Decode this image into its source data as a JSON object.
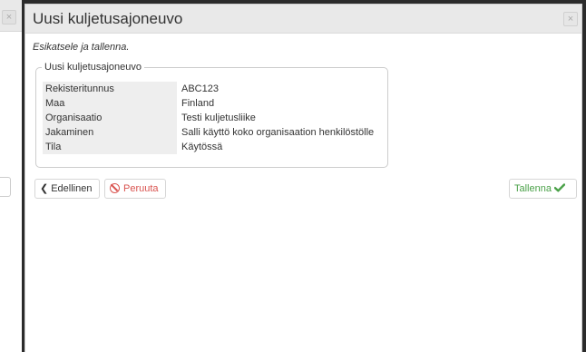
{
  "background_window": {
    "close_glyph": "×"
  },
  "dialog": {
    "title": "Uusi kuljetusajoneuvo",
    "close_glyph": "×",
    "instructions": "Esikatsele ja tallenna.",
    "fieldset_legend": "Uusi kuljetusajoneuvo",
    "rows": [
      {
        "label": "Rekisteritunnus",
        "value": "ABC123"
      },
      {
        "label": "Maa",
        "value": "Finland"
      },
      {
        "label": "Organisaatio",
        "value": "Testi kuljetusliike"
      },
      {
        "label": "Jakaminen",
        "value": "Salli käyttö koko organisaation henkilöstölle"
      },
      {
        "label": "Tila",
        "value": "Käytössä"
      }
    ],
    "buttons": {
      "previous_label": "Edellinen",
      "cancel_label": "Peruuta",
      "save_label": "Tallenna"
    }
  },
  "icons": {
    "previous": "chevron-left-icon",
    "cancel": "ban-icon",
    "save": "checkmark-icon"
  },
  "colors": {
    "header_bg": "#e9e9e9",
    "cancel": "#d9534f",
    "save": "#4aa148",
    "label_bg": "#eeeeee"
  }
}
